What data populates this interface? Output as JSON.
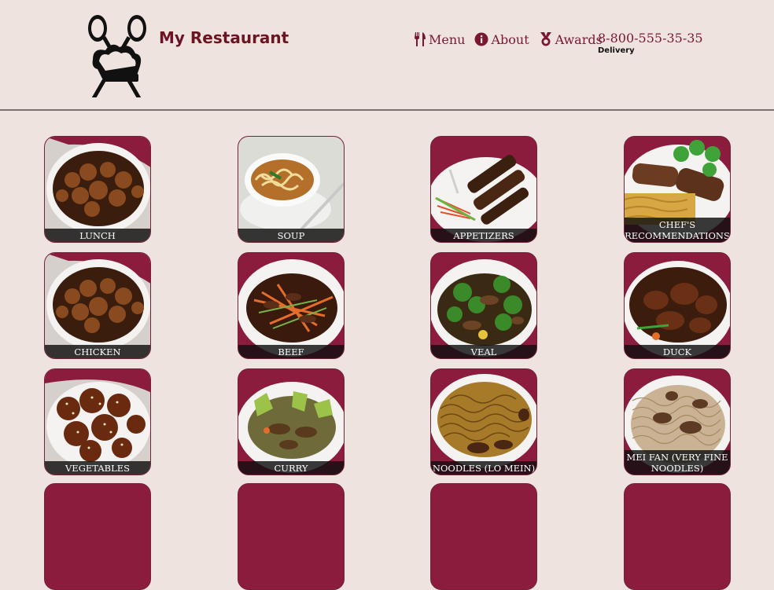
{
  "brand": {
    "name": "My Restaurant",
    "logo_icon": "spoon-chef-hat-logo-icon"
  },
  "nav": {
    "items": [
      {
        "label": "Menu",
        "icon": "fork-knife-icon"
      },
      {
        "label": "About",
        "icon": "info-icon"
      },
      {
        "label": "Awards",
        "icon": "medal-icon"
      }
    ],
    "phone": "8-800-555-35-35",
    "delivery": "Delivery"
  },
  "colors": {
    "background": "#efe3df",
    "accent": "#7a1832",
    "tile_border": "#6f2437",
    "caption_bg": "#0f0f0f"
  },
  "menu": [
    {
      "label": "LUNCH",
      "dish": "sweet-sour-chicken"
    },
    {
      "label": "SOUP",
      "dish": "noodle-soup"
    },
    {
      "label": "APPETIZERS",
      "dish": "skewers"
    },
    {
      "label": "CHEF'S RECOMMENDATIONS",
      "dish": "steak-noodles"
    },
    {
      "label": "CHICKEN",
      "dish": "sweet-sour-chicken"
    },
    {
      "label": "BEEF",
      "dish": "beef-carrot"
    },
    {
      "label": "VEAL",
      "dish": "veal-broccoli"
    },
    {
      "label": "DUCK",
      "dish": "duck"
    },
    {
      "label": "VEGETABLES",
      "dish": "sesame"
    },
    {
      "label": "CURRY",
      "dish": "curry"
    },
    {
      "label": "NOODLES (LO MEIN)",
      "dish": "lo-mein"
    },
    {
      "label": "MEI FAN (VERY FINE NOODLES)",
      "dish": "mei-fan"
    }
  ]
}
